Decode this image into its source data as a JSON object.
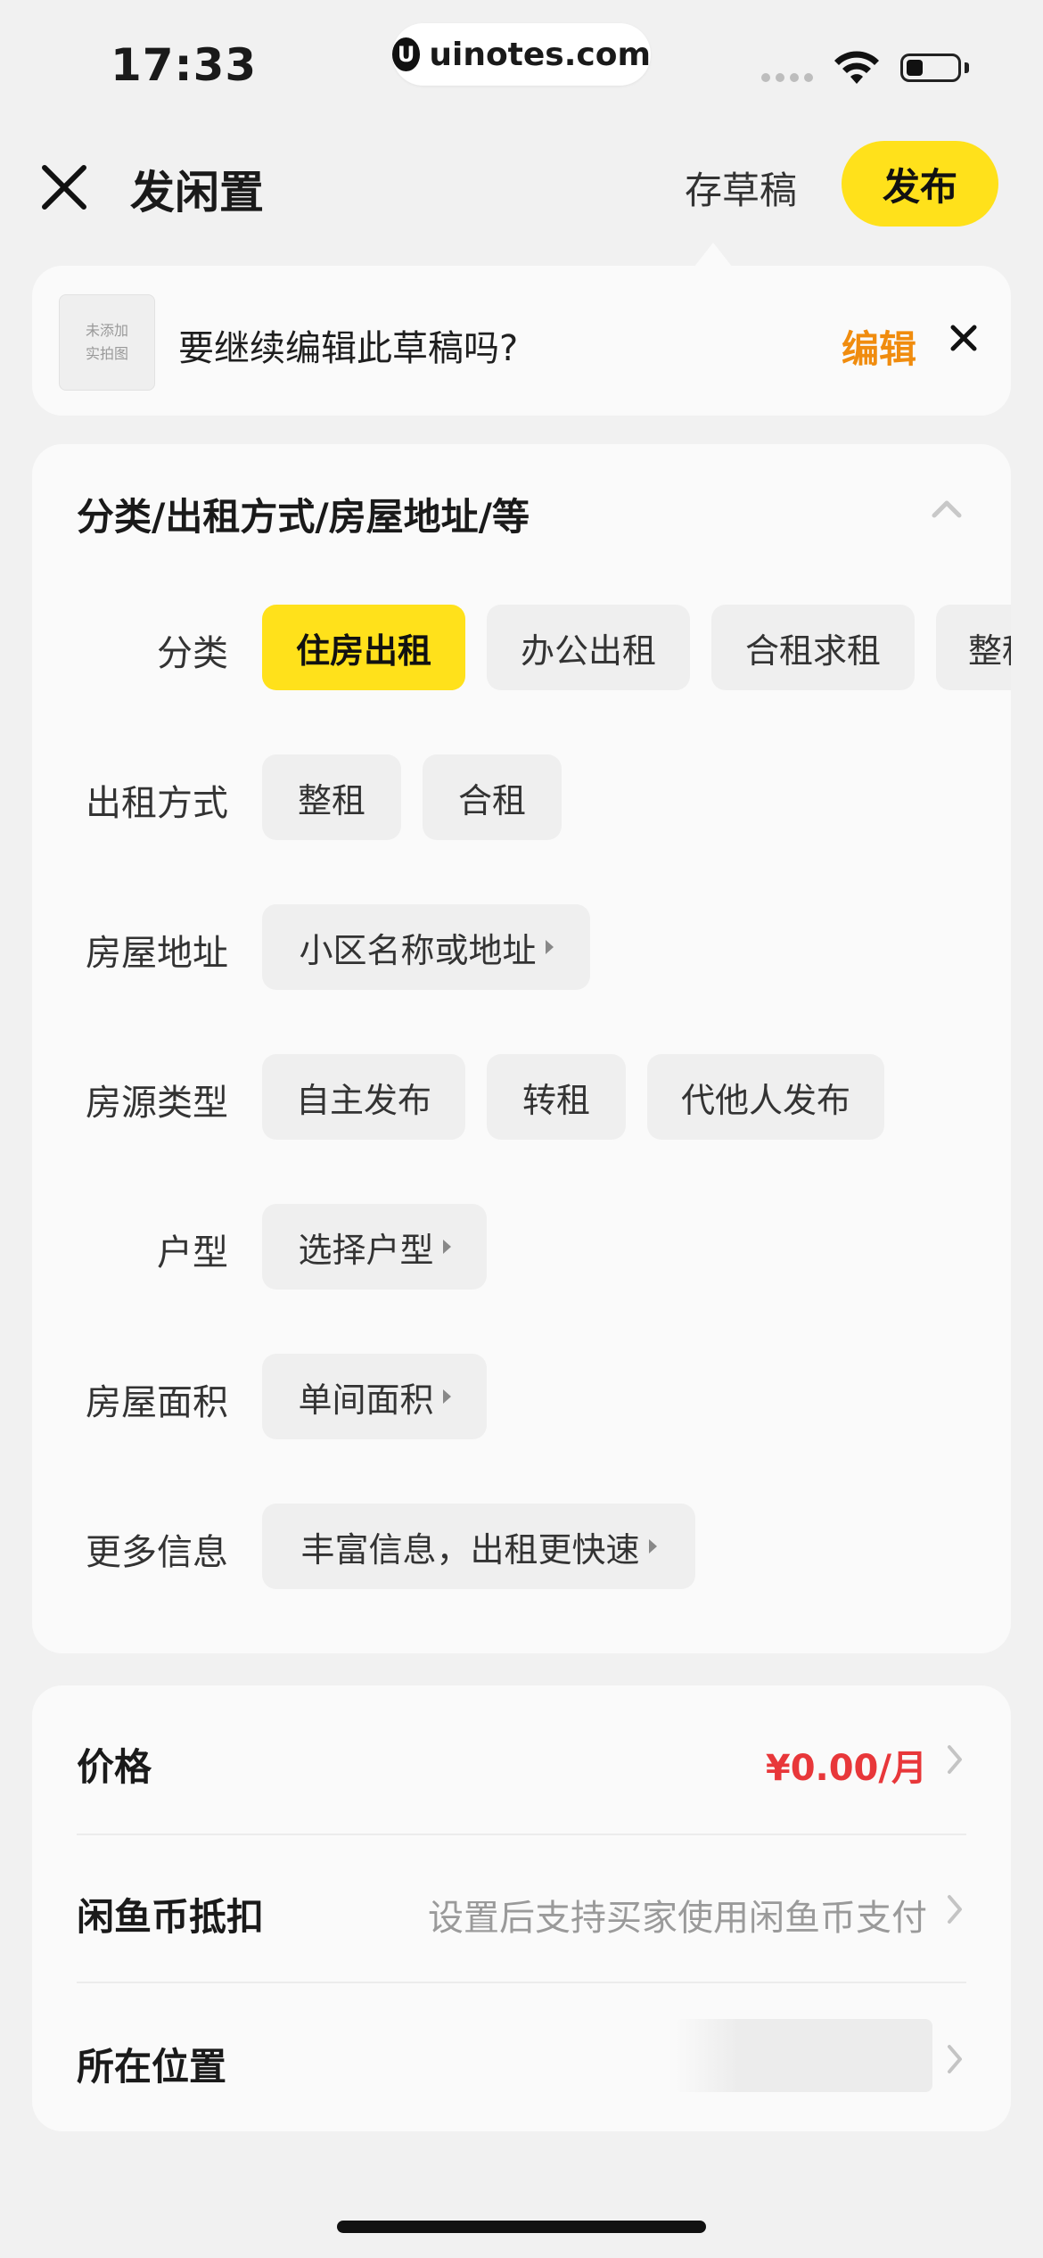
{
  "status_bar": {
    "time": "17:33",
    "watermark": "uinotes.com"
  },
  "header": {
    "title": "发闲置",
    "draft_label": "存草稿",
    "publish_label": "发布"
  },
  "draft_prompt": {
    "thumb_text_line1": "未添加",
    "thumb_text_line2": "实拍图",
    "message": "要继续编辑此草稿吗?",
    "edit_label": "编辑"
  },
  "form": {
    "section_title": "分类/出租方式/房屋地址/等",
    "rows": [
      {
        "label": "分类",
        "chips": [
          "住房出租",
          "办公出租",
          "合租求租",
          "整租"
        ],
        "selected": "住房出租"
      },
      {
        "label": "出租方式",
        "chips": [
          "整租",
          "合租"
        ]
      },
      {
        "label": "房屋地址",
        "chips": [
          "小区名称或地址"
        ]
      },
      {
        "label": "房源类型",
        "chips": [
          "自主发布",
          "转租",
          "代他人发布"
        ]
      },
      {
        "label": "户型",
        "chips": [
          "选择户型"
        ]
      },
      {
        "label": "房屋面积",
        "chips": [
          "单间面积"
        ]
      },
      {
        "label": "更多信息",
        "chips": [
          "丰富信息，出租更快速"
        ]
      }
    ]
  },
  "details": {
    "price_label": "价格",
    "price_value": "¥0.00/月",
    "coin_label": "闲鱼币抵扣",
    "coin_hint": "设置后支持买家使用闲鱼币支付",
    "location_label": "所在位置"
  },
  "colors": {
    "accent_yellow": "#ffe11b",
    "edit_orange": "#f08c0e",
    "price_red": "#e8373a"
  }
}
